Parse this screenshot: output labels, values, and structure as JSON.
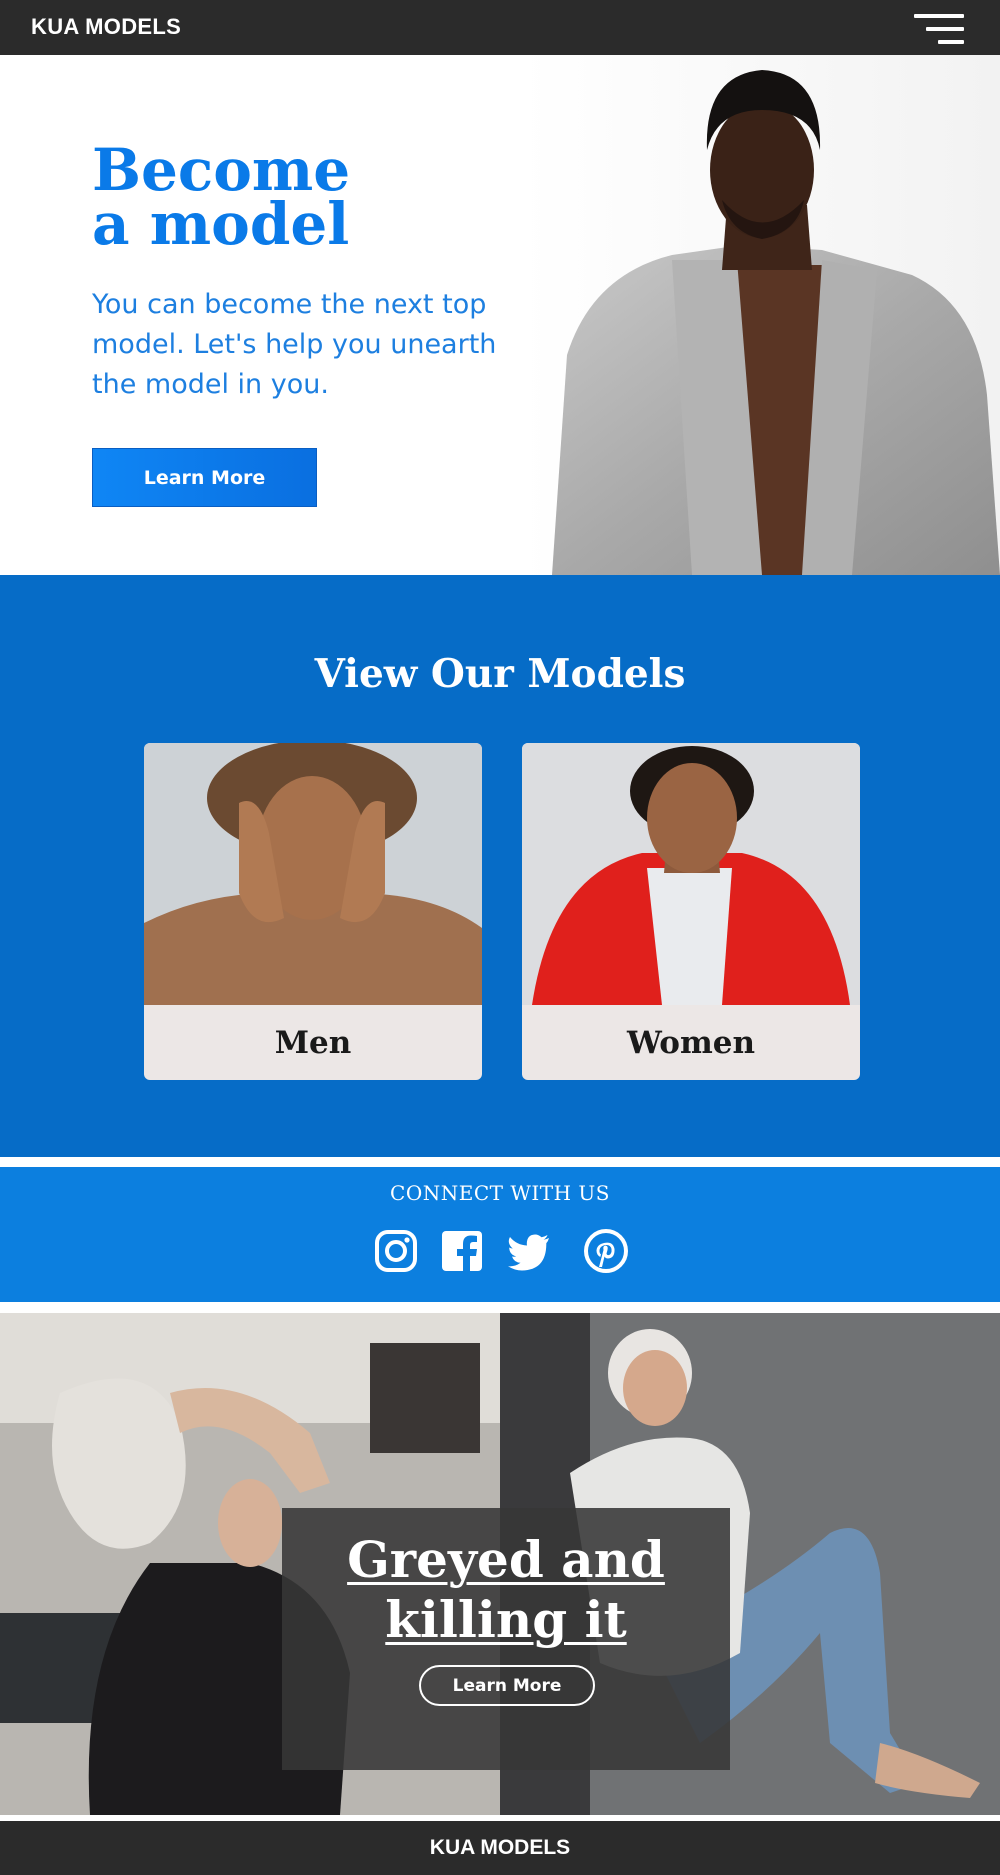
{
  "header": {
    "brand": "KUA MODELS",
    "menu_icon": "hamburger-menu-icon"
  },
  "hero": {
    "title": "Become\n a model",
    "text": "You can become the next top model. Let's help you unearth the model in you.",
    "button_label": "Learn More",
    "accent_color": "#0a7ae8"
  },
  "models": {
    "title": "View Our Models",
    "cards": [
      {
        "label": "Men"
      },
      {
        "label": "Women"
      }
    ],
    "background_color": "#066cc7"
  },
  "connect": {
    "title": "CONNECT WITH US",
    "icons": [
      "instagram-icon",
      "facebook-icon",
      "twitter-icon",
      "pinterest-icon"
    ],
    "background_color": "#0c7fdf"
  },
  "promo": {
    "title": "Greyed and killing it",
    "button_label": "Learn More"
  },
  "footer": {
    "brand": "KUA MODELS"
  }
}
